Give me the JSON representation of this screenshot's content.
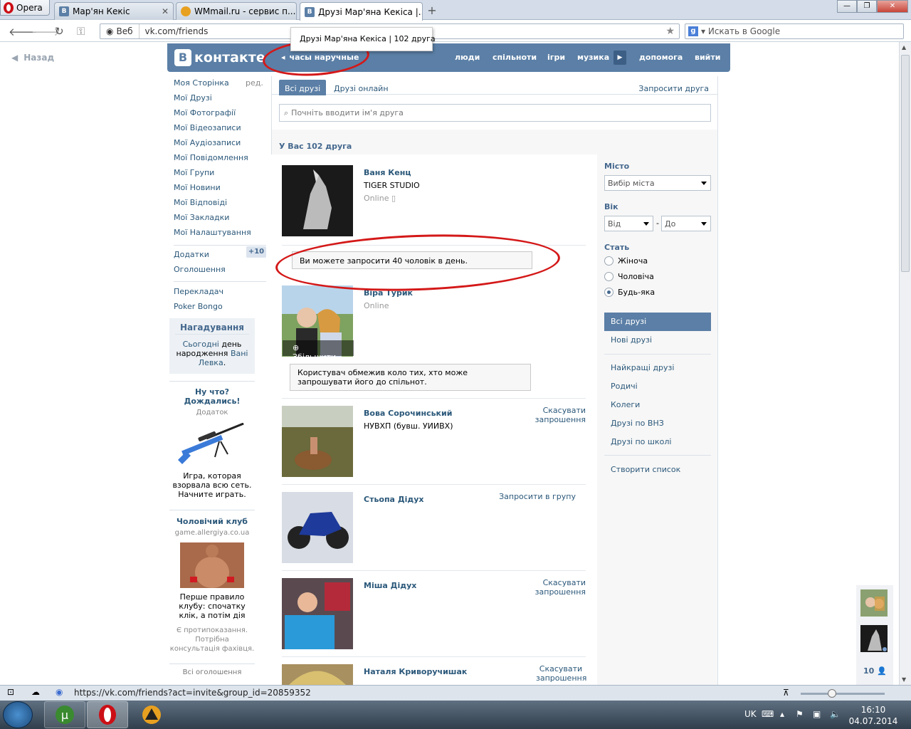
{
  "browser": {
    "menu_label": "Opera",
    "tabs": [
      {
        "title": "Мар'ян Кекіс"
      },
      {
        "title": "WMmail.ru - сервис п..."
      },
      {
        "title": "Друзі Мар'яна Кекіса |..."
      }
    ],
    "web_label": "Веб",
    "url": "vk.com/friends",
    "search_placeholder": "Искать в Google",
    "tooltip": "Друзі Мар'яна Кекіса | 102 друга",
    "status_url": "https://vk.com/friends?act=invite&group_id=20859352"
  },
  "page": {
    "back": "Назад",
    "logo": "контакте",
    "logo_badge": "В",
    "header_search": "часы наручные",
    "nav": [
      "люди",
      "спільноти",
      "ігри",
      "музика",
      "допомога",
      "вийти"
    ],
    "left_menu": [
      "Моя Сторінка",
      "Мої Друзі",
      "Мої Фотографії",
      "Мої Відеозаписи",
      "Мої Аудіозаписи",
      "Мої Повідомлення",
      "Мої Групи",
      "Мої Новини",
      "Мої Відповіді",
      "Мої Закладки",
      "Мої Налаштування"
    ],
    "edit": "ред.",
    "extra_menu": [
      "Додатки",
      "Оголошення"
    ],
    "extra_badge": "+10",
    "extra_menu2": [
      "Перекладач",
      "Poker Bongo"
    ],
    "reminder": {
      "title": "Нагадування",
      "pre": "Сьогодні",
      "mid": " день народження ",
      "link": "Вані Левка",
      "end": "."
    },
    "ad1": {
      "title": "Ну что? Дождались!",
      "sub": "Додаток",
      "text": "Игра, которая взорвала всю сеть. Начните играть."
    },
    "ad2": {
      "title": "Чоловічий клуб",
      "sub": "game.allergiya.co.ua",
      "text": "Перше правило клубу: спочатку клік, а потім дія",
      "note": "Є протипоказання. Потрібна консультація фахівця."
    },
    "all_ads": "Всі оголошення",
    "tabs": [
      "Всі друзі",
      "Друзі онлайн"
    ],
    "invite_friend": "Запросити друга",
    "friend_search_placeholder": "Почніть вводити ім'я друга",
    "count": "У Вас 102 друга",
    "friends": [
      {
        "name": "Ваня Кенц",
        "info": "TIGER STUDIO",
        "status": "Online",
        "action": ""
      },
      {
        "name": "Віра Турик",
        "info": "",
        "status": "Online",
        "action": ""
      },
      {
        "name": "Вова Сорочинський",
        "info": "НУВХП (бувш. УИИВХ)",
        "status": "",
        "action": "Скасувати запрошення"
      },
      {
        "name": "Стьопа Дідух",
        "info": "",
        "status": "",
        "action": "Запросити в групу"
      },
      {
        "name": "Міша Дідух",
        "info": "",
        "status": "",
        "action": "Скасувати запрошення"
      },
      {
        "name": "Наталя Криворучишак",
        "info": "",
        "status": "",
        "action": "Скасувати запрошення"
      }
    ],
    "notice1": "Ви можете запросити 40 чоловік в день.",
    "notice2": "Користувач обмежив коло тих, хто може запрошувати його до спільнот.",
    "zoom": "Збільшити",
    "filter": {
      "city_label": "Місто",
      "city_value": "Вибір міста",
      "age_label": "Вік",
      "age_from": "Від",
      "age_dash": "-",
      "age_to": "До",
      "sex_label": "Стать",
      "sex_options": [
        "Жіноча",
        "Чоловіча",
        "Будь-яка"
      ],
      "sex_selected": 2,
      "lists1": [
        "Всі друзі",
        "Нові друзі"
      ],
      "lists2": [
        "Найкращі друзі",
        "Родичі",
        "Колеги",
        "Друзі по ВНЗ",
        "Друзі по школі"
      ],
      "create_list": "Створити список"
    },
    "chat_count": "10"
  },
  "taskbar": {
    "lang": "UK",
    "time": "16:10",
    "date": "04.07.2014"
  },
  "colors": {
    "vk_blue": "#5b7fa6",
    "link": "#2b587a",
    "annotation": "#d41818"
  }
}
